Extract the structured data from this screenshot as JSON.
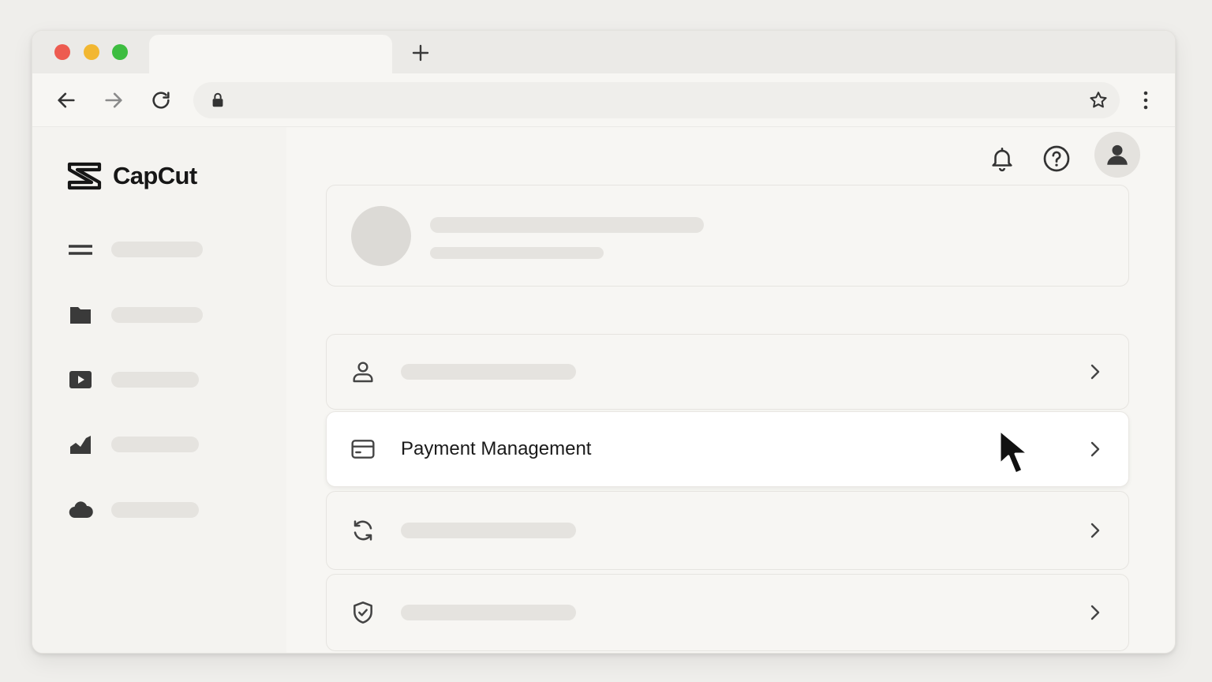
{
  "browser": {
    "icons": {
      "new_tab": "plus-icon",
      "back": "arrow-left-icon",
      "forward": "arrow-right-icon",
      "reload": "reload-icon",
      "lock": "lock-icon",
      "bookmark": "star-icon",
      "menu": "more-vertical-icon"
    },
    "window_controls": [
      "close",
      "minimize",
      "maximize"
    ],
    "colors": {
      "close": "#ed5b50",
      "minimize": "#f2b731",
      "maximize": "#3dbd40"
    }
  },
  "app": {
    "logo_text": "CapCut",
    "sidebar": {
      "items": [
        {
          "icon": "menu-icon"
        },
        {
          "icon": "folder-icon"
        },
        {
          "icon": "play-icon"
        },
        {
          "icon": "chart-icon"
        },
        {
          "icon": "cloud-icon"
        }
      ]
    },
    "header": {
      "icons": [
        "bell-icon",
        "help-icon",
        "user-avatar-icon"
      ]
    },
    "settings_rows": [
      {
        "icon": "user-icon",
        "label": "",
        "state": "placeholder"
      },
      {
        "icon": "credit-card-icon",
        "label": "Payment Management",
        "state": "hovered"
      },
      {
        "icon": "refresh-icon",
        "label": "",
        "state": "placeholder"
      },
      {
        "icon": "shield-check-icon",
        "label": "",
        "state": "placeholder"
      }
    ]
  },
  "theme": {
    "page_bg": "#efeeeb",
    "window_bg": "#f7f6f3",
    "placeholder": "#e5e3df",
    "text": "#1a1a1a"
  }
}
